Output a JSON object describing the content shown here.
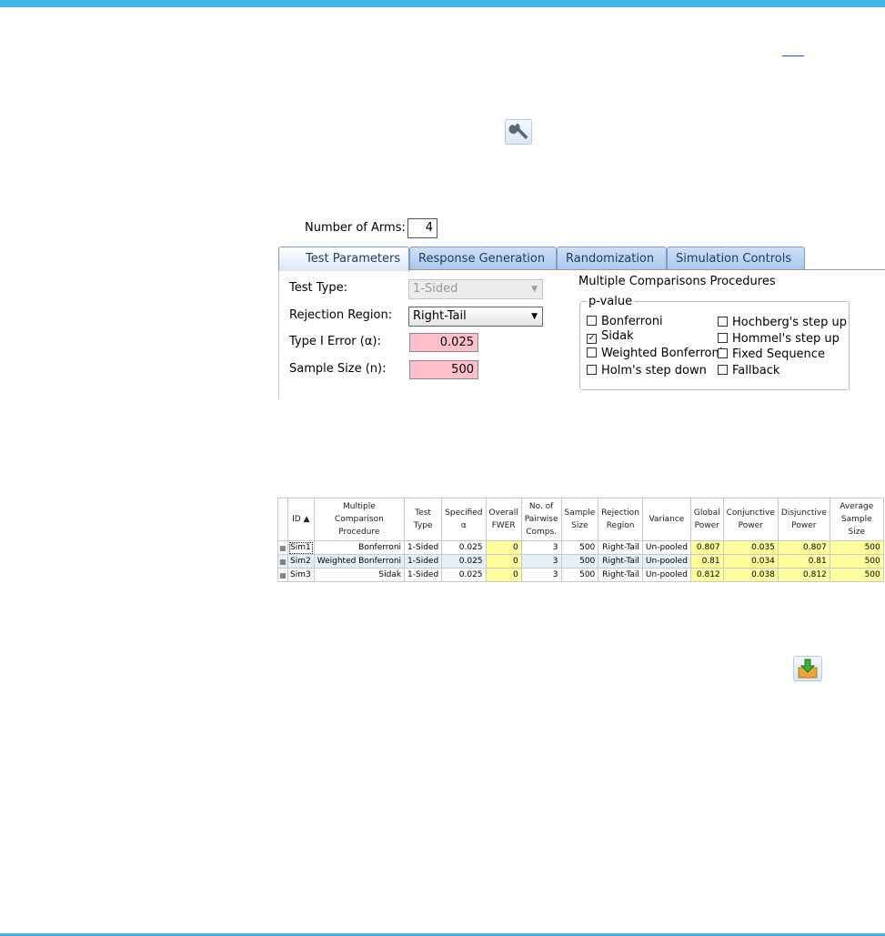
{
  "number_of_arms": {
    "label": "Number of Arms:",
    "value": "4"
  },
  "tabs": [
    {
      "label": "Test Parameters"
    },
    {
      "label": "Response Generation"
    },
    {
      "label": "Randomization"
    },
    {
      "label": "Simulation Controls"
    }
  ],
  "test_parameters": {
    "test_type": {
      "label": "Test Type:",
      "value": "1-Sided"
    },
    "rejection_region": {
      "label": "Rejection Region:",
      "value": "Right-Tail"
    },
    "type1_error": {
      "label": "Type I Error (α):",
      "value": "0.025"
    },
    "sample_size": {
      "label": "Sample Size (n):",
      "value": "500"
    }
  },
  "mcp": {
    "title": "Multiple Comparisons Procedures",
    "group_label": "p-value",
    "options": [
      {
        "label": "Bonferroni",
        "checked": false
      },
      {
        "label": "Sidak",
        "checked": true
      },
      {
        "label": "Weighted Bonferroni",
        "checked": false
      },
      {
        "label": "Holm's step down",
        "checked": false
      },
      {
        "label": "Hochberg's step up",
        "checked": false
      },
      {
        "label": "Hommel's step up",
        "checked": false
      },
      {
        "label": "Fixed Sequence",
        "checked": false
      },
      {
        "label": "Fallback",
        "checked": false
      }
    ]
  },
  "results": {
    "sort_indicator": "▲",
    "columns": [
      "ID",
      "Multiple Comparison Procedure",
      "Test Type",
      "Specified α",
      "Overall FWER",
      "No. of Pairwise Comps.",
      "Sample Size",
      "Rejection Region",
      "Variance",
      "Global Power",
      "Conjunctive Power",
      "Disjunctive Power",
      "Average Sample Size"
    ],
    "rows": [
      [
        "Sim1",
        "Bonferroni",
        "1-Sided",
        "0.025",
        "0",
        "3",
        "500",
        "Right-Tail",
        "Un-pooled",
        "0.807",
        "0.035",
        "0.807",
        "500"
      ],
      [
        "Sim2",
        "Weighted Bonferroni",
        "1-Sided",
        "0.025",
        "0",
        "3",
        "500",
        "Right-Tail",
        "Un-pooled",
        "0.81",
        "0.034",
        "0.81",
        "500"
      ],
      [
        "Sim3",
        "Sidak",
        "1-Sided",
        "0.025",
        "0",
        "3",
        "500",
        "Right-Tail",
        "Un-pooled",
        "0.812",
        "0.038",
        "0.812",
        "500"
      ]
    ]
  },
  "icons": {
    "settings": "wrench-icon",
    "export": "export-icon",
    "row": "sim-row-icon"
  },
  "colors": {
    "accent": "#41b6e6",
    "required_input": "#ffc0cb",
    "highlight": "#ffff9e"
  }
}
